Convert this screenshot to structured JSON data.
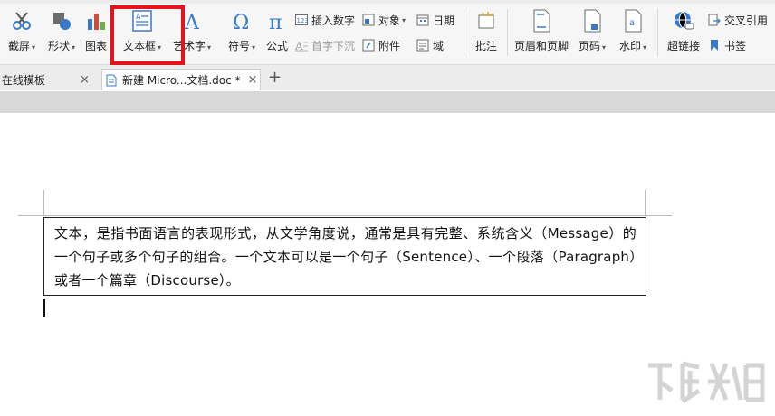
{
  "ribbon": {
    "screenshot_label": "截屏",
    "shape_label": "形状",
    "chart_label": "图表",
    "textbox_label": "文本框",
    "wordart_label": "艺术字",
    "symbol_label": "符号",
    "formula_label": "公式",
    "insert_number_label": "插入数字",
    "object_label": "对象",
    "date_label": "日期",
    "drop_cap_label": "首字下沉",
    "attachment_label": "附件",
    "field_label": "域",
    "comment_label": "批注",
    "header_footer_label": "页眉和页脚",
    "page_number_label": "页码",
    "watermark_label": "水印",
    "hyperlink_label": "超链接",
    "cross_ref_label": "交叉引用",
    "bookmark_label": "书签",
    "caret": "▾"
  },
  "tabs": [
    {
      "label": "在线模板",
      "close": "×"
    },
    {
      "label": "新建 Micro...文档.doc *",
      "close": "×"
    }
  ],
  "add_tab": "+",
  "document": {
    "text": "文本，是指书面语言的表现形式，从文学角度说，通常是具有完整、系统含义（Message）的一个句子或多个句子的组合。一个文本可以是一个句子（Sentence）、一个段落（Paragraph）或者一个篇章（Discourse）。"
  },
  "colors": {
    "highlight": "#e3141b",
    "icon_blue": "#3a79c9",
    "icon_gray": "#6b6b6b"
  }
}
